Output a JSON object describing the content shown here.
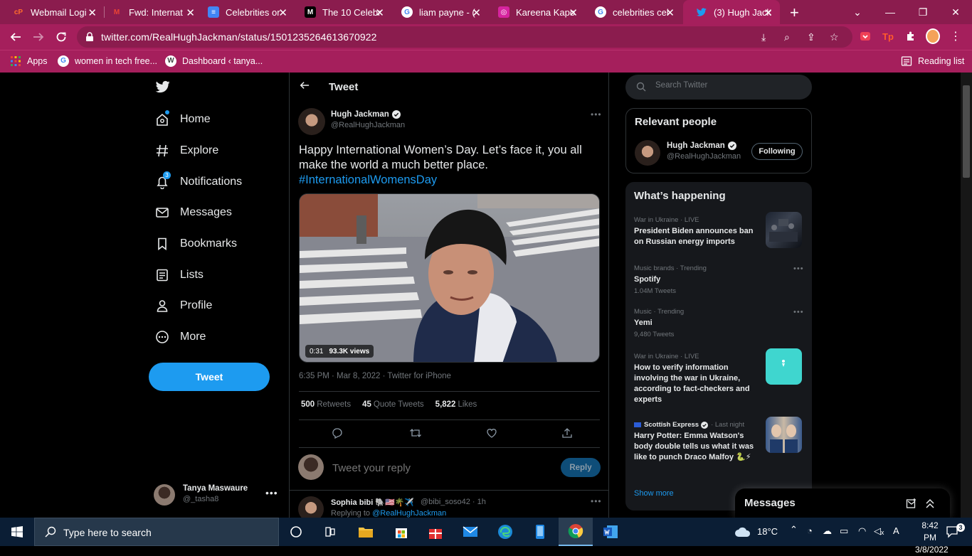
{
  "browser": {
    "tabs": [
      {
        "label": "Webmail Logi",
        "icon": "cpanel-icon",
        "color": "#ff6c2c",
        "glyph": "cP"
      },
      {
        "label": "Fwd: Internat",
        "icon": "gmail-icon",
        "color": "#ea4335",
        "glyph": "M"
      },
      {
        "label": "Celebrities or",
        "icon": "docs-icon",
        "color": "#4285f4",
        "glyph": "≡"
      },
      {
        "label": "The 10 Celebr",
        "icon": "medium-icon",
        "color": "#000000",
        "glyph": "M"
      },
      {
        "label": "liam payne - (",
        "icon": "google-icon",
        "color": "#ffffff",
        "glyph": "G"
      },
      {
        "label": "Kareena Kapo",
        "icon": "instagram-icon",
        "color": "#d6249f",
        "glyph": "◎"
      },
      {
        "label": "celebrities cel",
        "icon": "google-icon",
        "color": "#ffffff",
        "glyph": "G"
      },
      {
        "label": "(3) Hugh Jack",
        "icon": "twitter-icon",
        "color": "#1d9bf0",
        "glyph": ""
      }
    ],
    "url": "twitter.com/RealHughJackman/status/1501235264613670922",
    "bookmarks": {
      "apps": "Apps",
      "item1": "women in tech free...",
      "item2": "Dashboard ‹ tanya...",
      "reading_list": "Reading list"
    }
  },
  "nav": {
    "items": [
      {
        "label": "Home"
      },
      {
        "label": "Explore"
      },
      {
        "label": "Notifications",
        "badge": "3"
      },
      {
        "label": "Messages"
      },
      {
        "label": "Bookmarks"
      },
      {
        "label": "Lists"
      },
      {
        "label": "Profile"
      },
      {
        "label": "More"
      }
    ],
    "tweet_button": "Tweet",
    "account": {
      "name": "Tanya Maswaure",
      "handle": "@_tasha8"
    }
  },
  "main": {
    "header_title": "Tweet",
    "tweet": {
      "author_name": "Hugh Jackman",
      "author_handle": "@RealHughJackman",
      "text": "Happy International Women’s Day. Let’s face it, you all make the world a much better place.",
      "hashtag": "#InternationalWomensDay",
      "video_time": "0:31",
      "video_views": "93.3K views",
      "meta": "6:35 PM · Mar 8, 2022 · Twitter for iPhone",
      "retweets_count": "500",
      "retweets_label": "Retweets",
      "quotes_count": "45",
      "quotes_label": "Quote Tweets",
      "likes_count": "5,822",
      "likes_label": "Likes"
    },
    "reply_placeholder": "Tweet your reply",
    "reply_button": "Reply",
    "first_reply": {
      "name": "Sophia bibi 🐘🇺🇸🌴✈️",
      "handle_time": "@bibi_soso42 · 1h",
      "replying_prefix": "Replying to",
      "replying_to": "@RealHughJackman"
    }
  },
  "sidebar": {
    "search_placeholder": "Search Twitter",
    "relevant": {
      "title": "Relevant people",
      "name": "Hugh Jackman",
      "handle": "@RealHughJackman",
      "button": "Following"
    },
    "happening": {
      "title": "What’s happening",
      "trends": [
        {
          "context": "War in Ukraine · LIVE",
          "title": "President Biden announces ban on Russian energy imports",
          "count": ""
        },
        {
          "context": "Music brands · Trending",
          "title": "Spotify",
          "count": "1.04M Tweets"
        },
        {
          "context": "Music · Trending",
          "title": "Yemi",
          "count": "9,480 Tweets"
        },
        {
          "context": "War in Ukraine · LIVE",
          "title": "How to verify information involving the war in Ukraine, according to fact-checkers and experts",
          "count": ""
        },
        {
          "context_source": "Scottish Express",
          "context_time": "· Last night",
          "title": "Harry Potter: Emma Watson's body double tells us what it was like to punch Draco Malfoy 🐍⚡",
          "count": ""
        }
      ],
      "show_more": "Show more"
    }
  },
  "messages_drawer": {
    "title": "Messages"
  },
  "taskbar": {
    "search_placeholder": "Type here to search",
    "weather": "18°C",
    "time": "8:42 PM",
    "date": "3/8/2022"
  },
  "colors": {
    "accent": "#1d9bf0",
    "chrome": "#a51f5c",
    "chrome_dark": "#8b1c4e",
    "bg": "#000000"
  }
}
